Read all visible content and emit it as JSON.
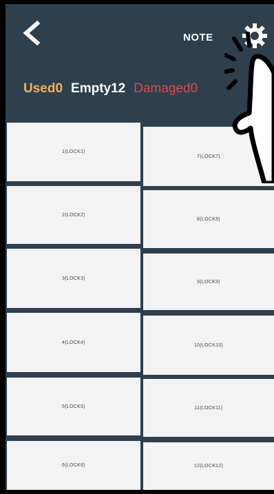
{
  "header": {
    "note_label": "NOTE",
    "stats": {
      "used": "Used0",
      "empty": "Empty12",
      "damaged": "Damaged0"
    },
    "icons": {
      "back": "chevron-left-icon",
      "settings": "gear-icon"
    }
  },
  "colors": {
    "background": "#2e3f4d",
    "cell": "#f3f3f3",
    "used": "#f5b15a",
    "empty": "#ffffff",
    "damaged": "#e04848"
  },
  "locks": {
    "left": [
      "1(LOCK1)",
      "2(LOCK2)",
      "3(LOCK3)",
      "4(LOCK4)",
      "5(LOCK5)",
      "6(LOCK6)"
    ],
    "right": [
      "7(LOCK7)",
      "8(LOCK8)",
      "9(LOCK9)",
      "10(LOCK10)",
      "11(LOCK11)",
      "12(LOCK12)"
    ]
  }
}
